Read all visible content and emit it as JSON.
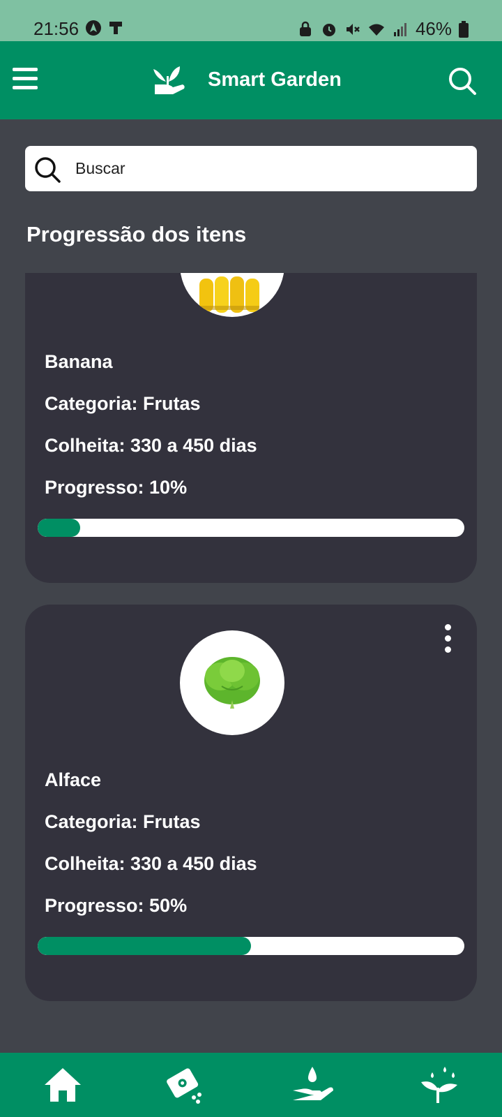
{
  "status_bar": {
    "time": "21:56",
    "battery": "46%",
    "left_icons": [
      "nav-arrow-icon",
      "sim-icon"
    ],
    "right_icons": [
      "lock-icon",
      "alarm-icon",
      "mute-icon",
      "wifi-icon",
      "signal-icon",
      "battery-icon"
    ]
  },
  "app_bar": {
    "title": "Smart Garden",
    "menu_icon": "menu-icon",
    "logo_icon": "plant-hand-icon",
    "search_icon": "search-icon"
  },
  "search": {
    "placeholder": "Buscar"
  },
  "section": {
    "title": "Progressão dos itens"
  },
  "items": [
    {
      "name": "Banana",
      "category": "Categoria: Frutas",
      "harvest": "Colheita: 330 a 450 dias",
      "progress_label": "Progresso: 10%",
      "progress": 10,
      "image": "banana"
    },
    {
      "name": "Alface",
      "category": "Categoria: Frutas",
      "harvest": "Colheita: 330 a 450 dias",
      "progress_label": "Progresso: 50%",
      "progress": 50,
      "image": "lettuce"
    }
  ],
  "bottom_nav": [
    {
      "icon": "home-icon"
    },
    {
      "icon": "seed-packet-icon"
    },
    {
      "icon": "hand-water-icon"
    },
    {
      "icon": "sprout-icon"
    }
  ],
  "colors": {
    "primary": "#008F63",
    "status_bar": "#7FC1A2",
    "background": "#41444B",
    "card": "#33323D"
  }
}
